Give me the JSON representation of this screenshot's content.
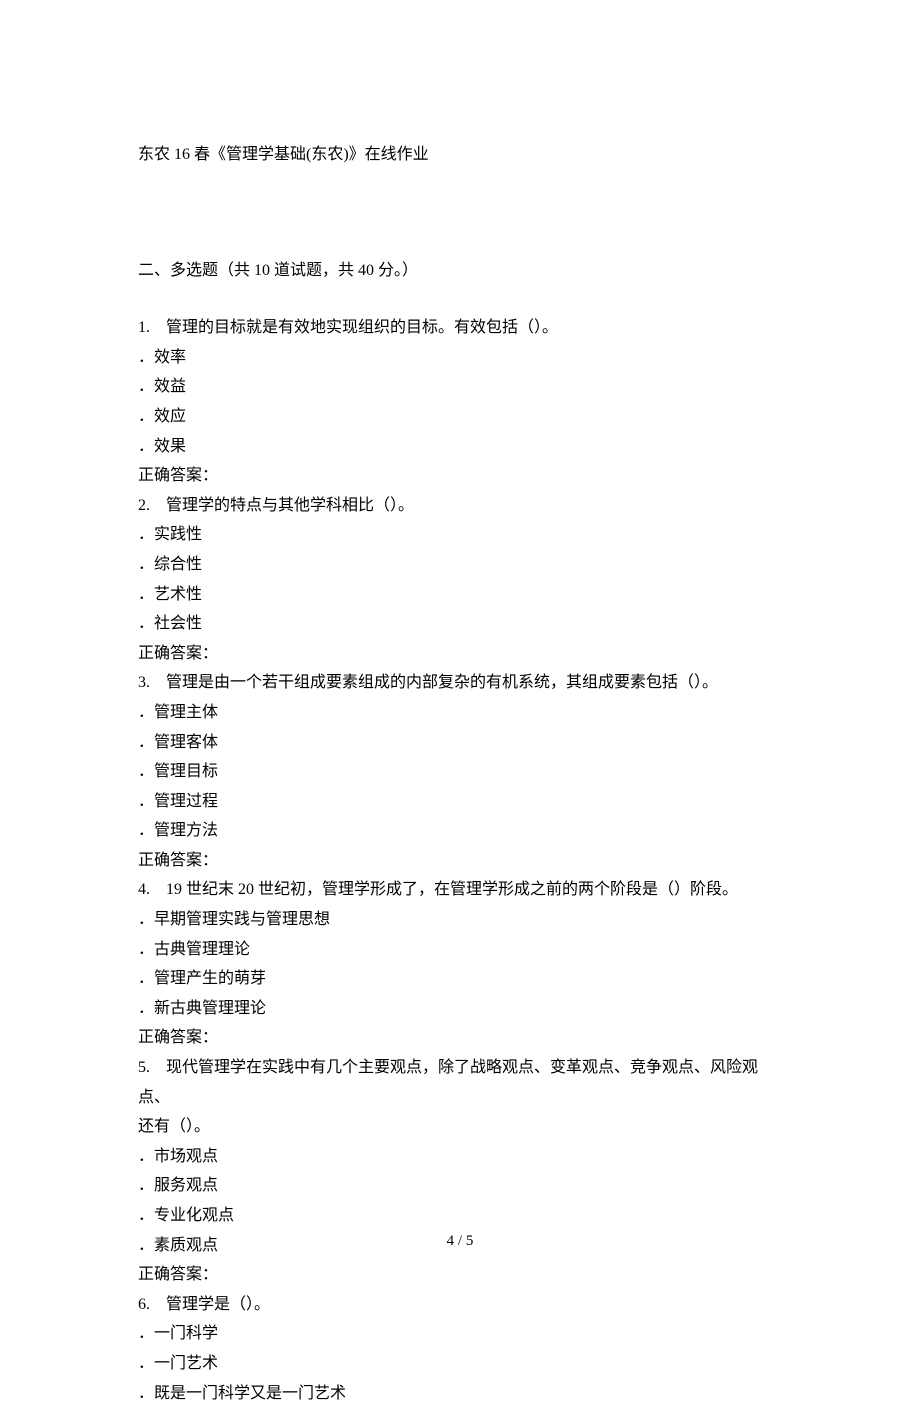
{
  "doc_title": "东农 16 春《管理学基础(东农)》在线作业",
  "section_header": "二、多选题（共 10 道试题，共 40 分。）",
  "questions": [
    {
      "num": "1.",
      "stem": "管理的目标就是有效地实现组织的目标。有效包括（）。",
      "options": [
        "效率",
        "效益",
        "效应",
        "效果"
      ],
      "answer_label": "正确答案："
    },
    {
      "num": "2.",
      "stem": "管理学的特点与其他学科相比（）。",
      "options": [
        "实践性",
        "综合性",
        "艺术性",
        "社会性"
      ],
      "answer_label": "正确答案："
    },
    {
      "num": "3.",
      "stem": "管理是由一个若干组成要素组成的内部复杂的有机系统，其组成要素包括（）。",
      "options": [
        "管理主体",
        "管理客体",
        "管理目标",
        "管理过程",
        "管理方法"
      ],
      "answer_label": "正确答案："
    },
    {
      "num": "4.",
      "stem": "19 世纪末 20 世纪初，管理学形成了，在管理学形成之前的两个阶段是（）阶段。",
      "options": [
        "早期管理实践与管理思想",
        "古典管理理论",
        "管理产生的萌芽",
        "新古典管理理论"
      ],
      "answer_label": "正确答案："
    },
    {
      "num": "5.",
      "stem_line1": "现代管理学在实践中有几个主要观点，除了战略观点、变革观点、竞争观点、风险观点、",
      "stem_line2": "还有（）。",
      "options": [
        "市场观点",
        "服务观点",
        "专业化观点",
        "素质观点"
      ],
      "answer_label": "正确答案："
    },
    {
      "num": "6.",
      "stem": "管理学是（）。",
      "options": [
        "一门科学",
        "一门艺术",
        "既是一门科学又是一门艺术"
      ],
      "answer_label": ""
    }
  ],
  "page_indicator": "4 / 5"
}
